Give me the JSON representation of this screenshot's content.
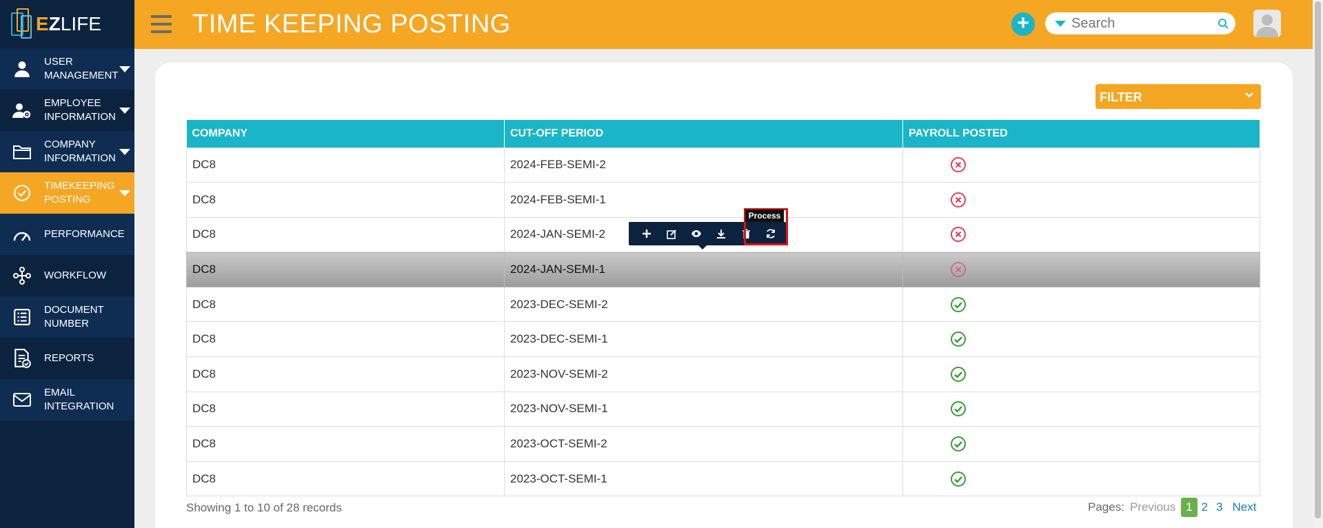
{
  "brand": {
    "e": "E",
    "z": "Z",
    "life": "LIFE"
  },
  "header": {
    "title": "TIME KEEPING POSTING"
  },
  "search": {
    "placeholder": "Search"
  },
  "sidebar": {
    "items": [
      {
        "label": "USER MANAGEMENT",
        "icon": "user-icon",
        "has_caret": true
      },
      {
        "label": "EMPLOYEE INFORMATION",
        "icon": "user-gear-icon",
        "has_caret": true
      },
      {
        "label": "COMPANY INFORMATION",
        "icon": "folder-icon",
        "has_caret": true
      },
      {
        "label": "TIMEKEEPING POSTING",
        "icon": "check-circle-icon",
        "has_caret": true,
        "active": true
      },
      {
        "label": "PERFORMANCE",
        "icon": "gauge-icon",
        "has_caret": false
      },
      {
        "label": "WORKFLOW",
        "icon": "workflow-icon",
        "has_caret": false
      },
      {
        "label": "DOCUMENT NUMBER",
        "icon": "list-icon",
        "has_caret": false
      },
      {
        "label": "REPORTS",
        "icon": "report-icon",
        "has_caret": false
      },
      {
        "label": "EMAIL INTEGRATION",
        "icon": "mail-icon",
        "has_caret": false
      }
    ]
  },
  "filter": {
    "label": "FILTER"
  },
  "table": {
    "headers": [
      "COMPANY",
      "CUT-OFF PERIOD",
      "PAYROLL POSTED"
    ],
    "rows": [
      {
        "company": "DC8",
        "period": "2024-FEB-SEMI-2",
        "posted": false
      },
      {
        "company": "DC8",
        "period": "2024-FEB-SEMI-1",
        "posted": false
      },
      {
        "company": "DC8",
        "period": "2024-JAN-SEMI-2",
        "posted": false
      },
      {
        "company": "DC8",
        "period": "2024-JAN-SEMI-1",
        "posted": false,
        "selected": true
      },
      {
        "company": "DC8",
        "period": "2023-DEC-SEMI-2",
        "posted": true
      },
      {
        "company": "DC8",
        "period": "2023-DEC-SEMI-1",
        "posted": true
      },
      {
        "company": "DC8",
        "period": "2023-NOV-SEMI-2",
        "posted": true
      },
      {
        "company": "DC8",
        "period": "2023-NOV-SEMI-1",
        "posted": true
      },
      {
        "company": "DC8",
        "period": "2023-OCT-SEMI-2",
        "posted": true
      },
      {
        "company": "DC8",
        "period": "2023-OCT-SEMI-1",
        "posted": true
      }
    ]
  },
  "toolbar": {
    "tooltip": "Process"
  },
  "footer": {
    "showing": "Showing 1 to 10 of 28 records",
    "pages_label": "Pages:",
    "previous": "Previous",
    "pages": [
      "1",
      "2",
      "3"
    ],
    "current_page": "1",
    "next": "Next"
  },
  "colors": {
    "accent": "#f5a623",
    "teal": "#1ab5c9",
    "navy": "#0c2340",
    "error": "#e0405a",
    "success": "#3a9a3a"
  }
}
